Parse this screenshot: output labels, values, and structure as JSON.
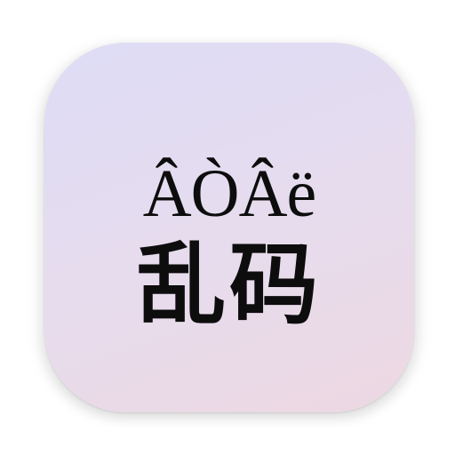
{
  "icon": {
    "garbled_text": "ÂÒÂë",
    "title_cn": "乱码",
    "background_colors": [
      "#dedcf6",
      "#e6dcee",
      "#edd8e2"
    ],
    "text_color": "#0d0d0d"
  }
}
